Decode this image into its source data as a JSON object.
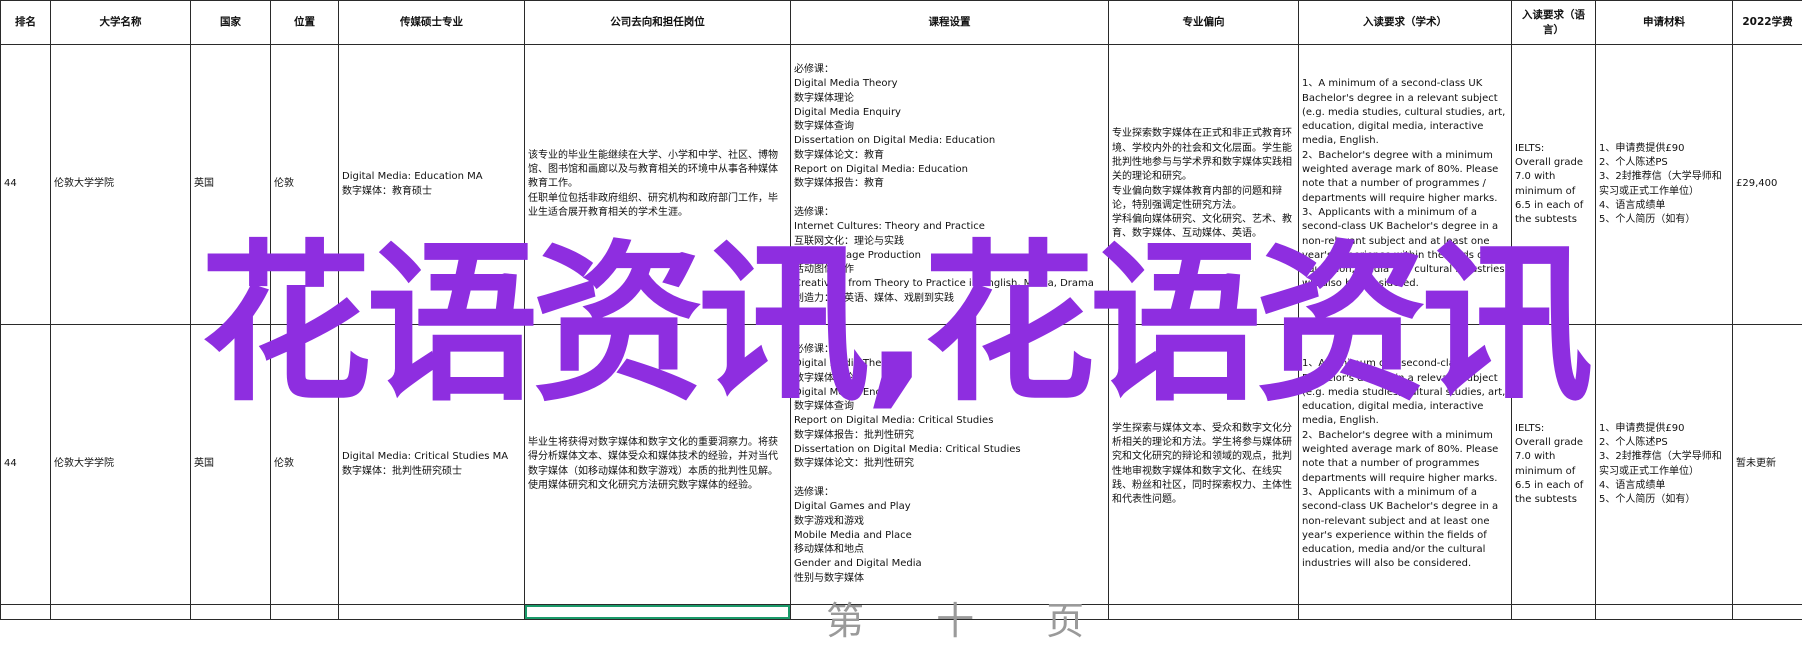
{
  "headers": [
    "排名",
    "大学名称",
    "国家",
    "位置",
    "传媒硕士专业",
    "公司去向和担任岗位",
    "课程设置",
    "专业偏向",
    "入读要求（学术）",
    "入读要求（语言）",
    "申请材料",
    "2022学费"
  ],
  "rows": [
    {
      "rank": "44",
      "university": "伦敦大学学院",
      "country": "英国",
      "location": "伦敦",
      "major": "Digital Media: Education MA\n数字媒体：教育硕士",
      "careers": "该专业的毕业生能继续在大学、小学和中学、社区、博物馆、图书馆和画廊以及与教育相关的环境中从事各种媒体教育工作。\n任职单位包括非政府组织、研究机构和政府部门工作，毕业生适合展开教育相关的学术生涯。",
      "courses": "必修课：\nDigital Media Theory\n数字媒体理论\nDigital Media Enquiry\n数字媒体查询\nDissertation on Digital Media: Education\n数字媒体论文：教育\nReport on Digital Media: Education\n数字媒体报告：教育\n\n选修课：\nInternet Cultures: Theory and Practice\n互联网文化：理论与实践\nMoving Image Production\n活动图像制作\nCreativity: from Theory to Practice in English, Media, Drama\n创造力：从英语、媒体、戏剧到实践",
      "focus": "专业探索数字媒体在正式和非正式教育环境、学校内外的社会和文化层面。学生能批判性地参与与学术界和数字媒体实践相关的理论和研究。\n专业偏向数字媒体教育内部的问题和辩论，特别强调定性研究方法。\n学科偏向媒体研究、文化研究、艺术、教育、数字媒体、互动媒体、英语。",
      "academic_req": "1、A minimum of a second-class UK Bachelor's degree in a relevant subject (e.g. media studies, cultural studies, art, education, digital media, interactive media, English.\n2、Bachelor's degree with a minimum weighted average mark of 80%. Please note that a number of programmes / departments will require higher marks.\n3、Applicants with a minimum of a second-class UK Bachelor's degree in a non-relevant subject and at least one year's experience within the fields of education, media and cultural industries will also be considered.",
      "language_req": "IELTS:\nOverall grade 7.0 with minimum of 6.5 in each of the subtests",
      "materials": "1、申请费提供£90\n2、个人陈述PS\n3、2封推荐信（大学导师和实习或正式工作单位）\n4、语言成绩单\n5、个人简历（如有）",
      "tuition": "£29,400"
    },
    {
      "rank": "44",
      "university": "伦敦大学学院",
      "country": "英国",
      "location": "伦敦",
      "major": "Digital Media: Critical Studies MA\n数字媒体：批判性研究硕士",
      "careers": "毕业生将获得对数字媒体和数字文化的重要洞察力。将获得分析媒体文本、媒体受众和媒体技术的经验，并对当代数字媒体（如移动媒体和数字游戏）本质的批判性见解。使用媒体研究和文化研究方法研究数字媒体的经验。",
      "courses": "必修课：\nDigital Media Theory\n数字媒体理论\nDigital Media Enquiry\n数字媒体查询\nReport on Digital Media: Critical Studies\n数字媒体报告：批判性研究\nDissertation on Digital Media: Critical Studies\n数字媒体论文：批判性研究\n\n选修课：\nDigital Games and Play\n数字游戏和游戏\nMobile Media and Place\n移动媒体和地点\nGender and Digital Media\n性别与数字媒体",
      "focus": "学生探索与媒体文本、受众和数字文化分析相关的理论和方法。学生将参与媒体研究和文化研究的辩论和领域的观点，批判性地审视数字媒体和数字文化、在线实践、粉丝和社区，同时探索权力、主体性和代表性问题。",
      "academic_req": "1、A minimum of a second-class UK Bachelor's degree in a relevant subject (e.g. media studies, cultural studies, art, education, digital media, interactive media, English.\n2、Bachelor's degree with a minimum weighted average mark of 80%. Please note that a number of programmes departments will require higher marks.\n3、Applicants with a minimum of a second-class UK Bachelor's degree in a non-relevant subject and at least one year's experience within the fields of education, media and/or the cultural industries will also be considered.",
      "language_req": "IELTS:\nOverall grade 7.0 with minimum of 6.5 in each of the subtests",
      "materials": "1、申请费提供£90\n2、个人陈述PS\n3、2封推荐信（大学导师和实习或正式工作单位）\n4、语言成绩单\n5、个人简历（如有）",
      "tuition": "暂未更新"
    }
  ],
  "watermark": "花语资讯,花语资讯",
  "ghost_text": "第 十 页"
}
